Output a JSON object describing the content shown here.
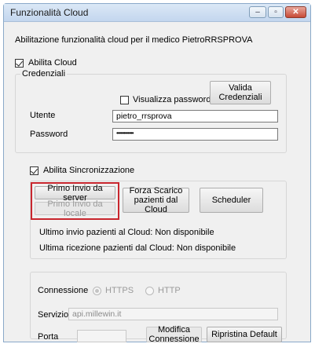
{
  "window": {
    "title": "Funzionalità Cloud"
  },
  "header_text": "Abilitazione funzionalità cloud per il medico  PietroRRSPROVA",
  "cloud": {
    "enable_label": "Abilita Cloud",
    "enable_checked": true,
    "credentials": {
      "legend": "Credenziali",
      "show_password_label": "Visualizza password",
      "show_password_checked": false,
      "validate_button": "Valida Credenziali",
      "user_label": "Utente",
      "user_value": "pietro_rrsprova",
      "password_label": "Password",
      "password_value": "••••••••••••"
    }
  },
  "sync": {
    "enable_label": "Abilita Sincronizzazione",
    "enable_checked": true,
    "first_send_server": "Primo Invio da server",
    "first_send_local": "Primo Invio da locale",
    "force_download": "Forza Scarico pazienti dal Cloud",
    "scheduler": "Scheduler",
    "last_send": "Ultimo invio pazienti al Cloud: Non disponibile",
    "last_receive": "Ultima ricezione pazienti dal Cloud: Non disponibile"
  },
  "connection": {
    "connection_label": "Connessione",
    "https_label": "HTTPS",
    "http_label": "HTTP",
    "selected": "HTTPS",
    "service_label": "Servizio",
    "service_value": "api.millewin.it",
    "port_label": "Porta",
    "port_value": "",
    "modify_button": "Modifica Connessione",
    "restore_button": "Ripristina Default"
  },
  "colors": {
    "highlight": "#c8262e",
    "titlebar": "#c3d6ee"
  },
  "icons": {
    "minimize": "minimize-icon",
    "maximize": "maximize-icon",
    "close": "close-icon"
  }
}
